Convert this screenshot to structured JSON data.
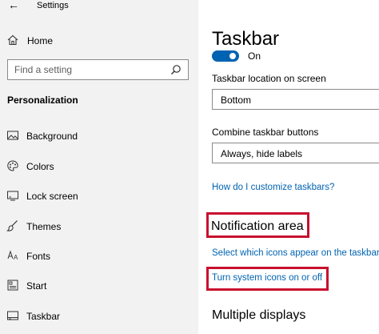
{
  "window": {
    "title": "Settings",
    "back_icon": "back-arrow-icon"
  },
  "sidebar": {
    "home": {
      "label": "Home",
      "icon": "home-icon"
    },
    "search": {
      "placeholder": "Find a setting",
      "icon": "search-icon"
    },
    "section_heading": "Personalization",
    "items": [
      {
        "label": "Background",
        "icon": "picture-icon"
      },
      {
        "label": "Colors",
        "icon": "palette-icon"
      },
      {
        "label": "Lock screen",
        "icon": "lock-screen-icon"
      },
      {
        "label": "Themes",
        "icon": "brush-icon"
      },
      {
        "label": "Fonts",
        "icon": "font-icon"
      },
      {
        "label": "Start",
        "icon": "start-icon"
      },
      {
        "label": "Taskbar",
        "icon": "taskbar-icon"
      }
    ]
  },
  "main": {
    "title": "Taskbar",
    "toggle": {
      "state_label": "On",
      "on": true
    },
    "taskbar_location": {
      "label": "Taskbar location on screen",
      "value": "Bottom"
    },
    "combine_buttons": {
      "label": "Combine taskbar buttons",
      "value": "Always, hide labels"
    },
    "customize_link": "How do I customize taskbars?",
    "notification_area": {
      "heading": "Notification area",
      "select_icons_link": "Select which icons appear on the taskbar",
      "system_icons_link": "Turn system icons on or off"
    },
    "multiple_displays_heading": "Multiple displays"
  },
  "colors": {
    "accent": "#0063b1",
    "highlight": "#c8102e",
    "sidebar_bg": "#f2f2f2"
  }
}
